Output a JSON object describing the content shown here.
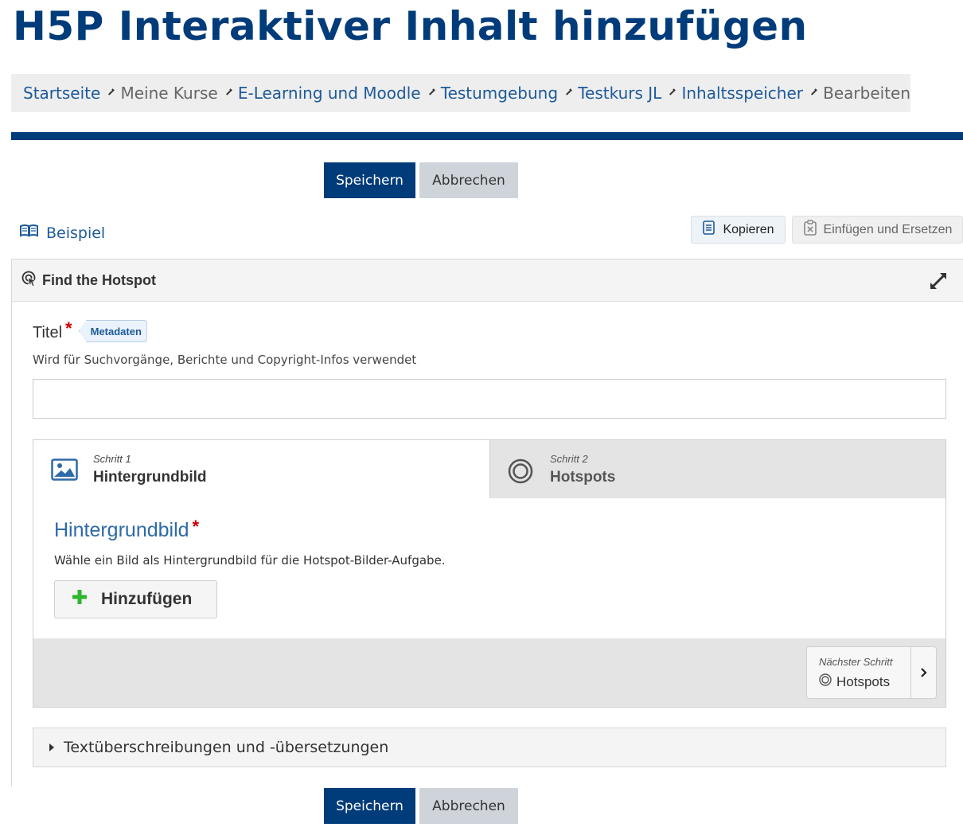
{
  "page": {
    "title": "H5P Interaktiver Inhalt hinzufügen"
  },
  "breadcrumb": [
    {
      "label": "Startseite",
      "muted": false
    },
    {
      "label": "Meine Kurse",
      "muted": true
    },
    {
      "label": "E-Learning und Moodle",
      "muted": false
    },
    {
      "label": "Testumgebung",
      "muted": false
    },
    {
      "label": "Testkurs JL",
      "muted": false
    },
    {
      "label": "Inhaltsspeicher",
      "muted": false
    },
    {
      "label": "Bearbeiten",
      "muted": true
    }
  ],
  "actions": {
    "save_label": "Speichern",
    "cancel_label": "Abbrechen"
  },
  "toolbar": {
    "example_label": "Beispiel",
    "copy_label": "Kopieren",
    "paste_label": "Einfügen und Ersetzen"
  },
  "editor": {
    "content_type": "Find the Hotspot",
    "title_field": {
      "label": "Titel",
      "required_mark": "*",
      "metadata_label": "Metadaten",
      "description": "Wird für Suchvorgänge, Berichte und Copyright-Infos verwendet",
      "value": ""
    },
    "wizard": {
      "steps": [
        {
          "step_label": "Schritt 1",
          "title": "Hintergrundbild",
          "icon": "image-icon"
        },
        {
          "step_label": "Schritt 2",
          "title": "Hotspots",
          "icon": "hotspot-icon"
        }
      ],
      "section_title": "Hintergrundbild",
      "section_required": "*",
      "section_description": "Wähle ein Bild als Hintergrundbild für die Hotspot-Bilder-Aufgabe.",
      "add_label": "Hinzufügen",
      "next_step_label": "Nächster Schritt",
      "next_step_target": "Hotspots"
    },
    "overrides_label": "Textüberschreibungen und -übersetzungen"
  },
  "colors": {
    "brand": "#003b7a",
    "link": "#1d5a9a",
    "required": "#cc0000",
    "add_plus": "#2fb52f"
  }
}
